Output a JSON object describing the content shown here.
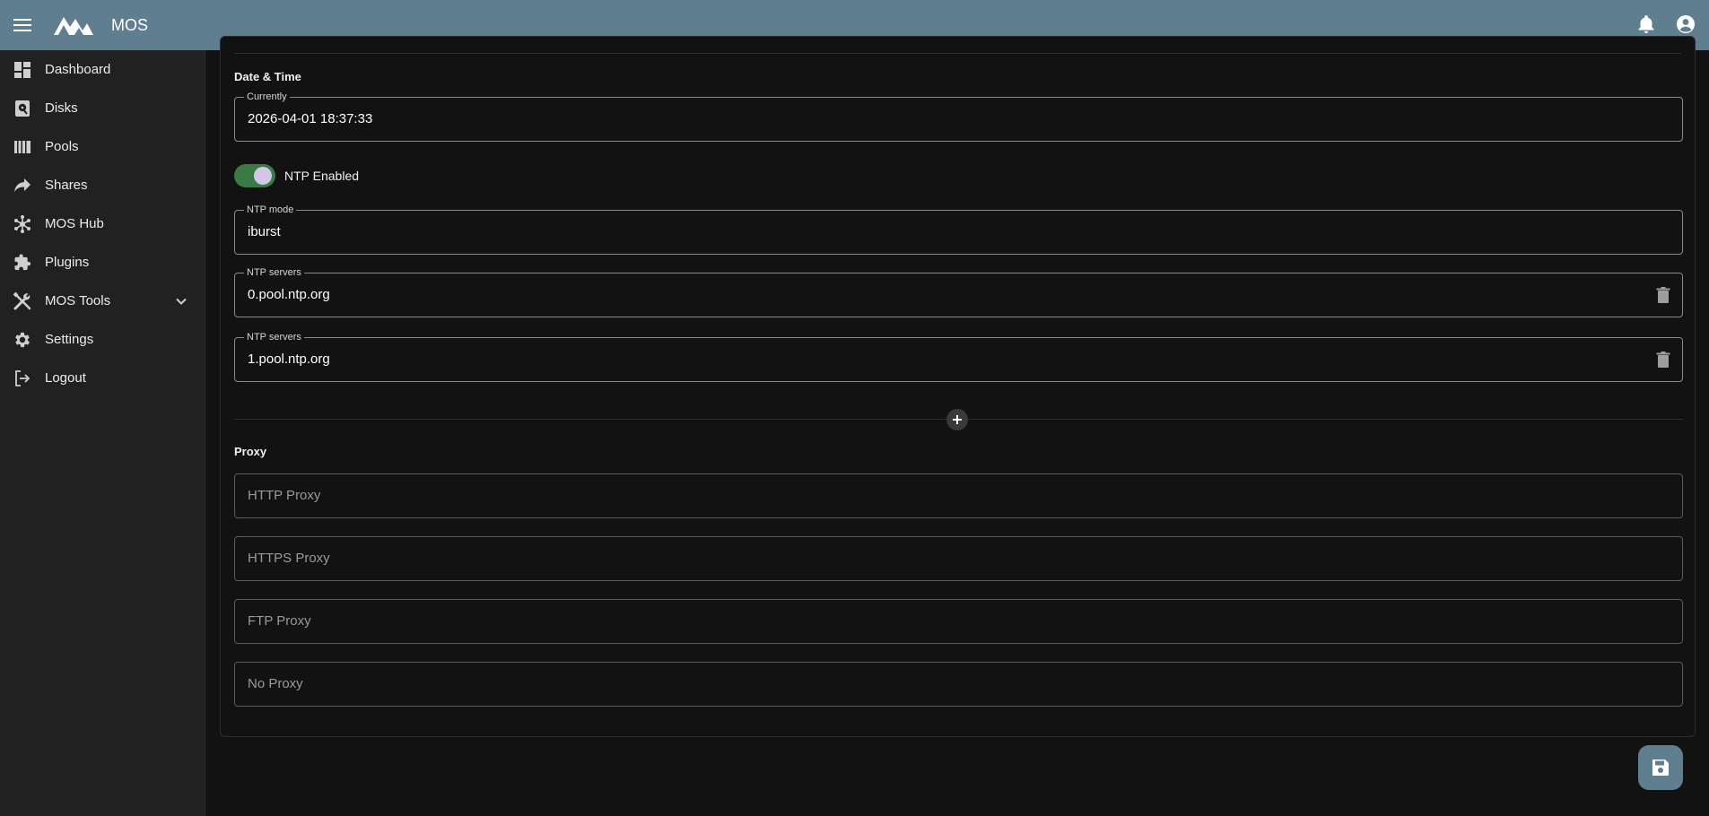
{
  "app": {
    "title": "MOS"
  },
  "topbar": {
    "icons": [
      "menu-icon",
      "logo",
      "bell-icon",
      "account-circle-icon"
    ]
  },
  "sidebar": {
    "items": [
      {
        "label": "Dashboard",
        "icon": "dashboard-icon"
      },
      {
        "label": "Disks",
        "icon": "disk-icon"
      },
      {
        "label": "Pools",
        "icon": "pools-icon"
      },
      {
        "label": "Shares",
        "icon": "share-icon"
      },
      {
        "label": "MOS Hub",
        "icon": "hub-icon"
      },
      {
        "label": "Plugins",
        "icon": "puzzle-icon"
      },
      {
        "label": "MOS Tools",
        "icon": "tools-icon",
        "expandable": true
      },
      {
        "label": "Settings",
        "icon": "gear-icon"
      },
      {
        "label": "Logout",
        "icon": "logout-icon"
      }
    ]
  },
  "datetime": {
    "title": "Date & Time",
    "currently_label": "Currently",
    "currently_value": "2026-04-01 18:37:33",
    "ntp_enabled_label": "NTP Enabled",
    "ntp_enabled": true,
    "ntp_mode_label": "NTP mode",
    "ntp_mode_value": "iburst",
    "ntp_servers": [
      {
        "label": "NTP servers",
        "value": "0.pool.ntp.org"
      },
      {
        "label": "NTP servers",
        "value": "1.pool.ntp.org"
      }
    ]
  },
  "proxy": {
    "title": "Proxy",
    "http_placeholder": "HTTP Proxy",
    "https_placeholder": "HTTPS Proxy",
    "ftp_placeholder": "FTP Proxy",
    "no_proxy_placeholder": "No Proxy"
  },
  "colors": {
    "topbar": "#5f7f90",
    "sidebar": "#212121",
    "background": "#121212",
    "switch_on": "#3a7a45",
    "fab": "#5f7f90"
  }
}
